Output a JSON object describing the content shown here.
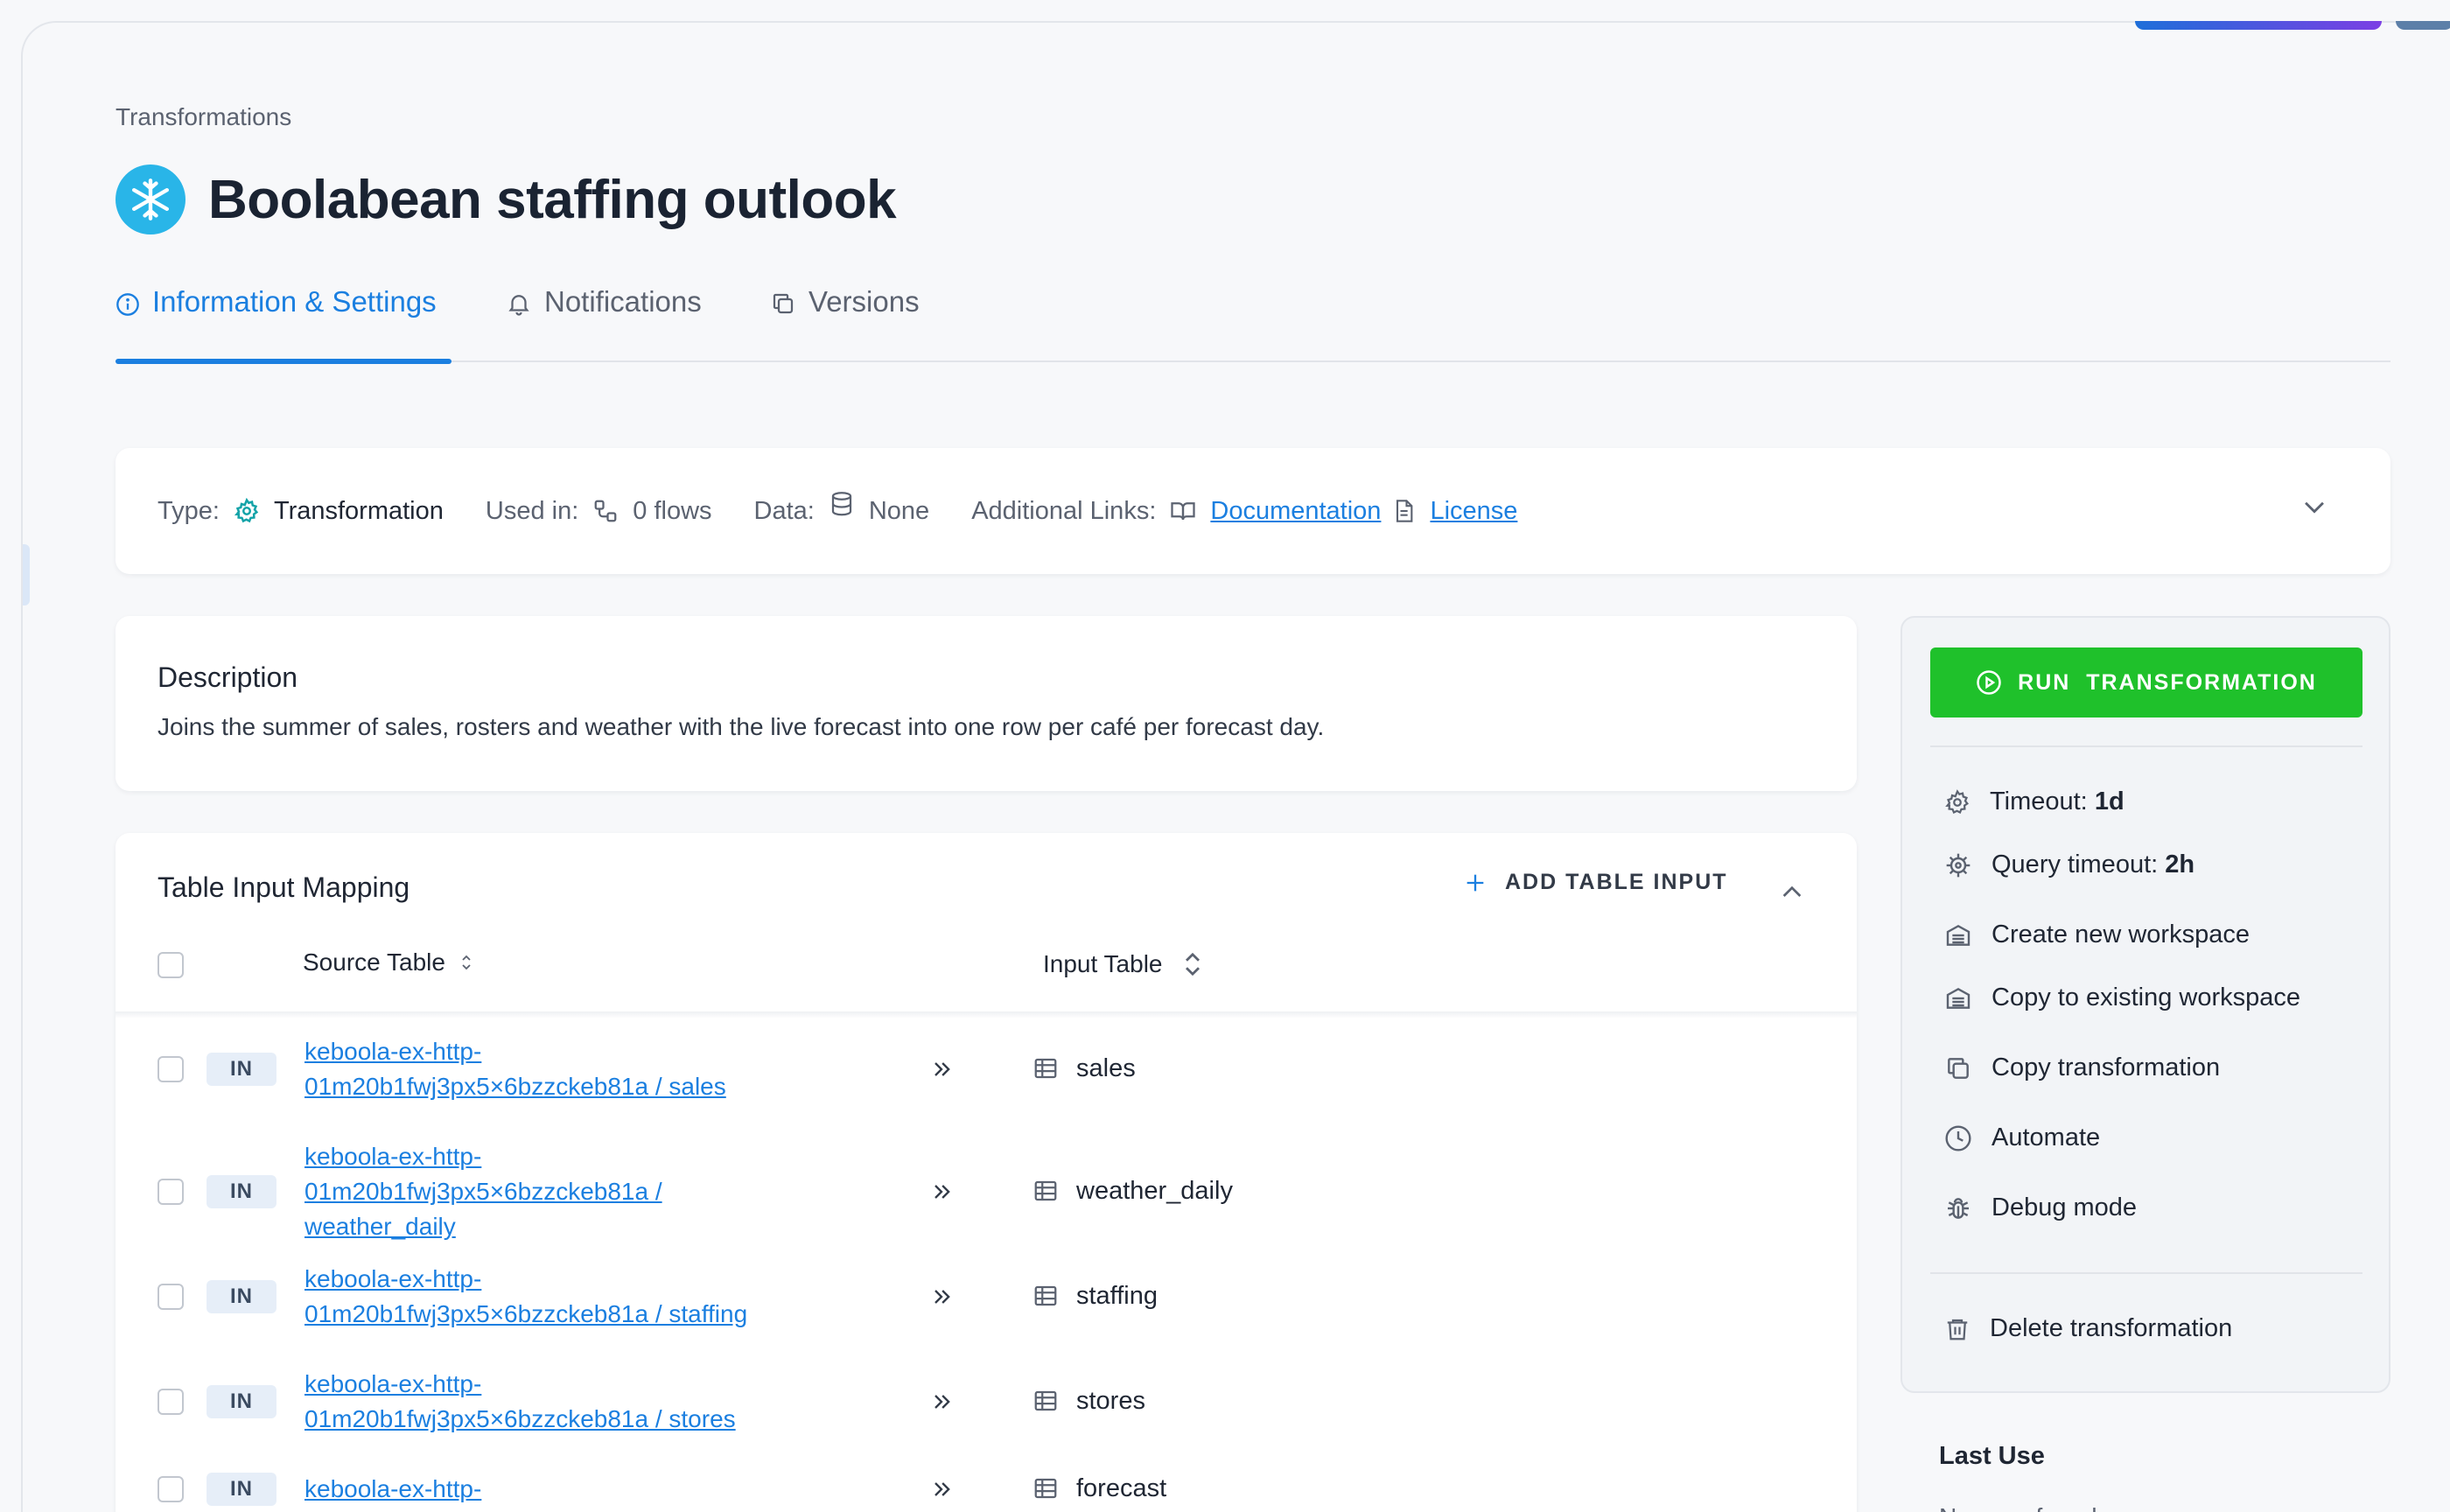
{
  "breadcrumb": "Transformations",
  "title": "Boolabean staffing outlook",
  "tabs": [
    {
      "label": "Information & Settings",
      "icon": "info-icon",
      "active": true
    },
    {
      "label": "Notifications",
      "icon": "bell-icon",
      "active": false
    },
    {
      "label": "Versions",
      "icon": "copy-icon",
      "active": false
    }
  ],
  "info": {
    "type_label": "Type:",
    "type_value": "Transformation",
    "used_label": "Used in:",
    "used_value": "0 flows",
    "data_label": "Data:",
    "data_value": "None",
    "links_label": "Additional Links:",
    "doc_link": "Documentation",
    "license_link": "License"
  },
  "description": {
    "title": "Description",
    "text": "Joins the summer of sales, rosters and weather with the live forecast into one row per café per forecast day."
  },
  "mapping": {
    "title": "Table Input Mapping",
    "add_label": "ADD TABLE INPUT",
    "col_source": "Source Table",
    "col_input": "Input Table",
    "rows": [
      {
        "badge": "IN",
        "source": "keboola-ex-http-01m20b1fwj3px5×6bzzckeb81a / sales",
        "lines": [
          "keboola-ex-http-",
          "01m20b1fwj3px5×6bzzckeb81a / sales"
        ],
        "table": "sales"
      },
      {
        "badge": "IN",
        "source": "keboola-ex-http-01m20b1fwj3px5×6bzzckeb81a / weather_daily",
        "lines": [
          "keboola-ex-http-",
          "01m20b1fwj3px5×6bzzckeb81a /",
          "weather_daily"
        ],
        "table": "weather_daily"
      },
      {
        "badge": "IN",
        "source": "keboola-ex-http-01m20b1fwj3px5×6bzzckeb81a / staffing",
        "lines": [
          "keboola-ex-http-",
          "01m20b1fwj3px5×6bzzckeb81a / staffing"
        ],
        "table": "staffing"
      },
      {
        "badge": "IN",
        "source": "keboola-ex-http-01m20b1fwj3px5×6bzzckeb81a / stores",
        "lines": [
          "keboola-ex-http-",
          "01m20b1fwj3px5×6bzzckeb81a / stores"
        ],
        "table": "stores"
      },
      {
        "badge": "IN",
        "source": "keboola-ex-http-…",
        "lines": [
          "keboola-ex-http-"
        ],
        "table": "forecast"
      }
    ]
  },
  "side_panel": {
    "run_label": "RUN  TRANSFORMATION",
    "timeout_label": "Timeout:",
    "timeout_value": "1d",
    "query_timeout_label": "Query timeout:",
    "query_timeout_value": "2h",
    "create_workspace": "Create new workspace",
    "copy_workspace": "Copy to existing workspace",
    "copy_transformation": "Copy transformation",
    "automate": "Automate",
    "debug": "Debug mode",
    "delete": "Delete transformation",
    "last_use_title": "Last Use",
    "last_use_text": "No uses found"
  },
  "colors": {
    "accent": "#1b7fe0",
    "run_button": "#1fc12b",
    "snowflake": "#29b5e8"
  }
}
